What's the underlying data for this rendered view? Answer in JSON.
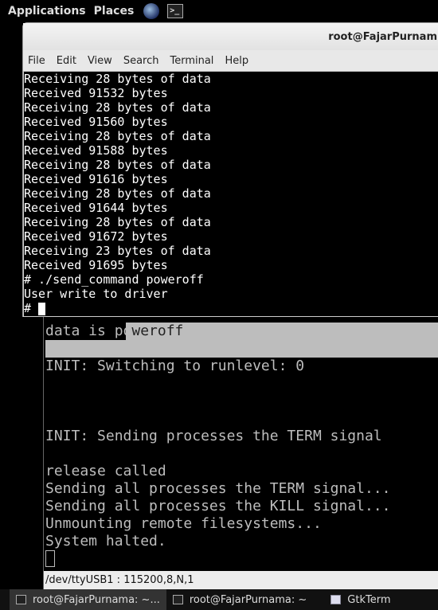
{
  "topbar": {
    "applications": "Applications",
    "places": "Places"
  },
  "terminal": {
    "title": "root@FajarPurnam",
    "menu": [
      "File",
      "Edit",
      "View",
      "Search",
      "Terminal",
      "Help"
    ],
    "lines": [
      "Receiving 28 bytes of data",
      "Received 91532 bytes",
      "Receiving 28 bytes of data",
      "Received 91560 bytes",
      "Receiving 28 bytes of data",
      "Received 91588 bytes",
      "Receiving 28 bytes of data",
      "Received 91616 bytes",
      "Receiving 28 bytes of data",
      "Received 91644 bytes",
      "Receiving 28 bytes of data",
      "Received 91672 bytes",
      "Receiving 23 bytes of data",
      "Received 91695 bytes",
      "# ./send_command poweroff",
      "User write to driver"
    ],
    "prompt": "# "
  },
  "gtkterm": {
    "lines": [
      {
        "row": 0,
        "text": "data is poweroff"
      },
      {
        "row": 2,
        "text": "INIT: Switching to runlevel: 0"
      },
      {
        "row": 6,
        "text": "INIT: Sending processes the TERM signal"
      },
      {
        "row": 8,
        "text": "release called"
      },
      {
        "row": 9,
        "text": "Sending all processes the TERM signal..."
      },
      {
        "row": 10,
        "text": "Sending all processes the KILL signal..."
      },
      {
        "row": 11,
        "text": "Unmounting remote filesystems..."
      },
      {
        "row": 12,
        "text": "System halted."
      }
    ],
    "status": "/dev/ttyUSB1 : 115200,8,N,1"
  },
  "taskbar": [
    {
      "label": "root@FajarPurnama: ~...",
      "icon": "terminal-icon",
      "active": true
    },
    {
      "label": "root@FajarPurnama: ~",
      "icon": "terminal-icon",
      "active": false
    },
    {
      "label": "GtkTerm",
      "icon": "window-icon",
      "active": false
    }
  ]
}
